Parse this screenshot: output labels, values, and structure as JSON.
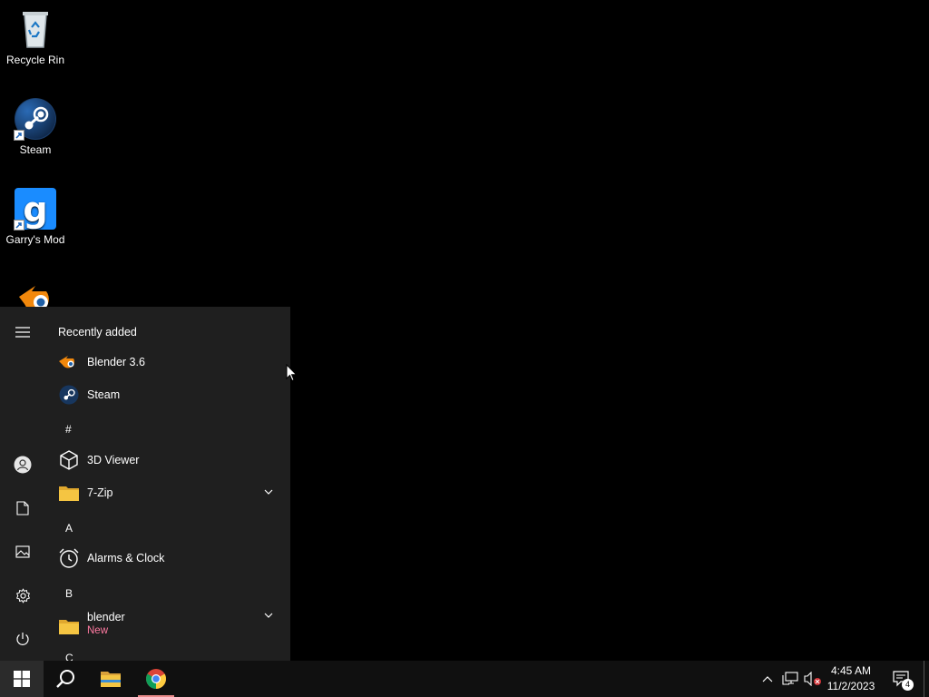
{
  "desktop": {
    "icons": [
      {
        "label": "Recycle Rin",
        "icon": "recycle-bin-icon"
      },
      {
        "label": "Steam",
        "icon": "steam-icon"
      },
      {
        "label": "Garry's Mod",
        "icon": "garrys-mod-icon"
      },
      {
        "label": "",
        "icon": "blender-icon"
      }
    ]
  },
  "start_menu": {
    "section_title": "Recently added",
    "rail": [
      "menu-icon",
      "user-icon",
      "documents-icon",
      "pictures-icon",
      "settings-icon",
      "power-icon"
    ],
    "apps": [
      {
        "label": "Blender 3.6",
        "icon": "blender-icon"
      },
      {
        "label": "Steam",
        "icon": "steam-icon"
      },
      {
        "letter": "#"
      },
      {
        "label": "3D Viewer",
        "icon": "cube-icon"
      },
      {
        "label": "7-Zip",
        "icon": "folder-icon",
        "expandable": true
      },
      {
        "letter": "A"
      },
      {
        "label": "Alarms & Clock",
        "icon": "alarm-clock-icon"
      },
      {
        "letter": "B"
      },
      {
        "label": "blender",
        "sublabel": "New",
        "icon": "folder-icon",
        "expandable": true
      },
      {
        "letter": "C"
      }
    ]
  },
  "taskbar": {
    "pinned": [
      "windows-start-icon",
      "search-icon",
      "file-explorer-icon",
      "chrome-icon"
    ],
    "clock_time": "4:45 AM",
    "clock_date": "11/2/2023",
    "notification_count": "4"
  },
  "colors": {
    "desktop_bg": "#000000",
    "start_menu_bg": "#1f1f1f",
    "taskbar_bg": "#101010",
    "new_badge": "#ff7aa1",
    "folder": "#f5c542",
    "chrome_active_underline": "#e88a8a"
  }
}
